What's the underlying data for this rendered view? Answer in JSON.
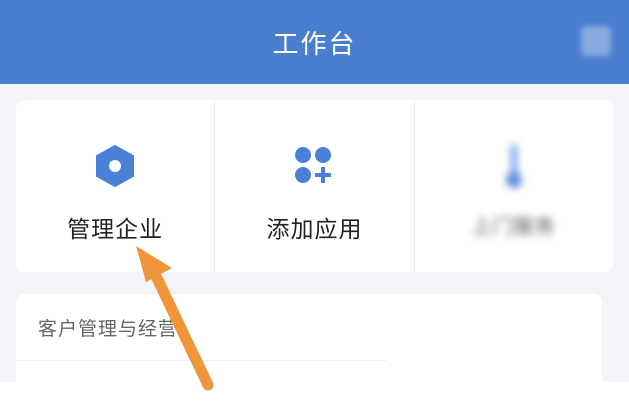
{
  "header": {
    "title": "工作台",
    "icon": "search-icon"
  },
  "tiles": [
    {
      "label": "管理企业",
      "icon": "hexagon-icon",
      "color": "#4a80d8"
    },
    {
      "label": "添加应用",
      "icon": "apps-plus-icon",
      "color": "#4a80d8"
    },
    {
      "label": "上门服务",
      "icon": "thermometer-icon",
      "color": "#6d9be6"
    }
  ],
  "section": {
    "title": "客户管理与经营"
  },
  "colors": {
    "header_bg": "#4a7ecf",
    "page_bg": "#f2f4f7",
    "accent": "#4a80d8",
    "arrow": "#f0953a"
  }
}
